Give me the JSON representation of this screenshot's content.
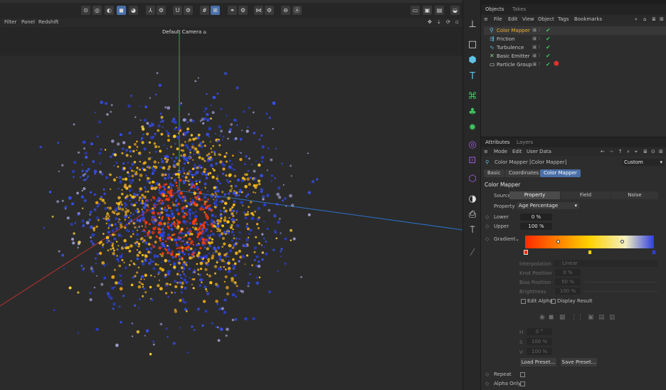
{
  "viewport_menu": {
    "filter": "Filter",
    "panel": "Panel",
    "redshift": "Redshift"
  },
  "camera_label": "Default Camera",
  "camera_icon": "camera-icon",
  "objects_panel": {
    "tabs": [
      "Objects",
      "Takes"
    ],
    "menu": [
      "File",
      "Edit",
      "View",
      "Object",
      "Tags",
      "Bookmarks"
    ],
    "rows": [
      {
        "name": "Color Mapper",
        "icon": "color-mapper-icon",
        "selected": true
      },
      {
        "name": "Friction",
        "icon": "friction-icon",
        "selected": false
      },
      {
        "name": "Turbulence",
        "icon": "turbulence-icon",
        "selected": false
      },
      {
        "name": "Basic Emitter",
        "icon": "emitter-icon",
        "selected": false
      },
      {
        "name": "Particle Group",
        "icon": "folder-icon",
        "selected": false
      }
    ]
  },
  "attributes_panel": {
    "tabs": [
      "Attributes",
      "Layers"
    ],
    "menu": [
      "Mode",
      "Edit",
      "User Data"
    ],
    "object_title": "Color Mapper [Color Mapper]",
    "preset": "Custom",
    "sub_tabs": [
      "Basic",
      "Coordinates",
      "Color Mapper"
    ],
    "section_title": "Color Mapper",
    "source_label": "Source",
    "source_options": [
      "Property",
      "Field",
      "Noise"
    ],
    "property_label": "Property",
    "property_value": "Age Percentage",
    "lower_label": "Lower",
    "lower_value": "0 %",
    "upper_label": "Upper",
    "upper_value": "100 %",
    "gradient_label": "Gradient",
    "gradient_colors": [
      "#ff2a00",
      "#ffd200",
      "#f4f0c0",
      "#2f3ee0"
    ],
    "interpolation_label": "Interpolation",
    "interpolation_value": "Linear",
    "knot_position_label": "Knot Position",
    "knot_position_value": "0 %",
    "bias_position_label": "Bias Position",
    "bias_position_value": "50 %",
    "brightness_label": "Brightness",
    "brightness_value": "100 %",
    "edit_alpha": "Edit Alpha",
    "display_result": "Display Result",
    "h_label": "H",
    "h_value": "0 °",
    "s_label": "S",
    "s_value": "100 %",
    "v_label": "V",
    "v_value": "100 %",
    "load_preset": "Load Preset...",
    "save_preset": "Save Preset...",
    "repeat_label": "Repeat",
    "alpha_only_label": "Alpha Only"
  }
}
